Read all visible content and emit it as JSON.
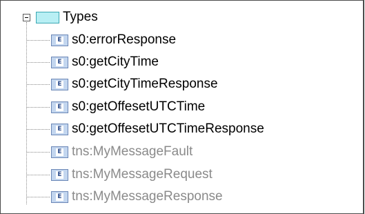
{
  "tree": {
    "root": {
      "label": "Types",
      "expander": "−",
      "icon": "folder-icon",
      "expanded": true
    },
    "items": [
      {
        "label": "s0:errorResponse",
        "badge": "E",
        "icon": "element-icon",
        "dimmed": false
      },
      {
        "label": "s0:getCityTime",
        "badge": "E",
        "icon": "element-icon",
        "dimmed": false
      },
      {
        "label": "s0:getCityTimeResponse",
        "badge": "E",
        "icon": "element-icon",
        "dimmed": false
      },
      {
        "label": "s0:getOffesetUTCTime",
        "badge": "E",
        "icon": "element-icon",
        "dimmed": false
      },
      {
        "label": "s0:getOffesetUTCTimeResponse",
        "badge": "E",
        "icon": "element-icon",
        "dimmed": false
      },
      {
        "label": "tns:MyMessageFault",
        "badge": "E",
        "icon": "element-icon",
        "dimmed": true
      },
      {
        "label": "tns:MyMessageRequest",
        "badge": "E",
        "icon": "element-icon",
        "dimmed": true
      },
      {
        "label": "tns:MyMessageResponse",
        "badge": "E",
        "icon": "element-icon",
        "dimmed": true
      }
    ]
  },
  "colors": {
    "folder_fill": "#b8eff4",
    "element_icon_fill": "#c3d6ef",
    "dimmed_text": "#8a8a8a"
  }
}
